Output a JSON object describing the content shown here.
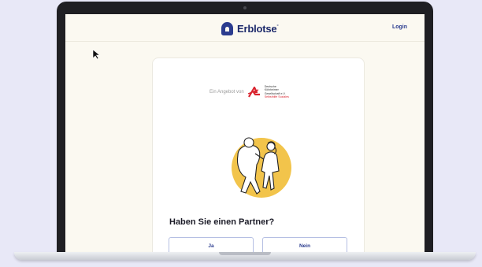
{
  "app": {
    "brand_name": "Erblotse",
    "brand_mark": "°"
  },
  "header": {
    "login_label": "Login"
  },
  "card": {
    "offer_prefix": "Ein Angebot von",
    "partner": {
      "line1": "Deutsche Kölnheimer",
      "line2": "Gesellschaft e.V.",
      "line3": "Selbsthilfe Soziales"
    },
    "question": "Haben Sie einen Partner?",
    "answers": [
      {
        "label": "Ja"
      },
      {
        "label": "Nein"
      }
    ]
  },
  "colors": {
    "brand": "#2b3c8f",
    "screen_bg": "#fbf9f1",
    "page_bg": "#e8e8f7",
    "illustration_circle": "#f2c44b",
    "partner_red": "#d9232e"
  },
  "icons": {
    "logo": "erblotse-logo-icon",
    "partner_logo": "partner-logo-icon",
    "cursor": "mouse-cursor-icon"
  }
}
